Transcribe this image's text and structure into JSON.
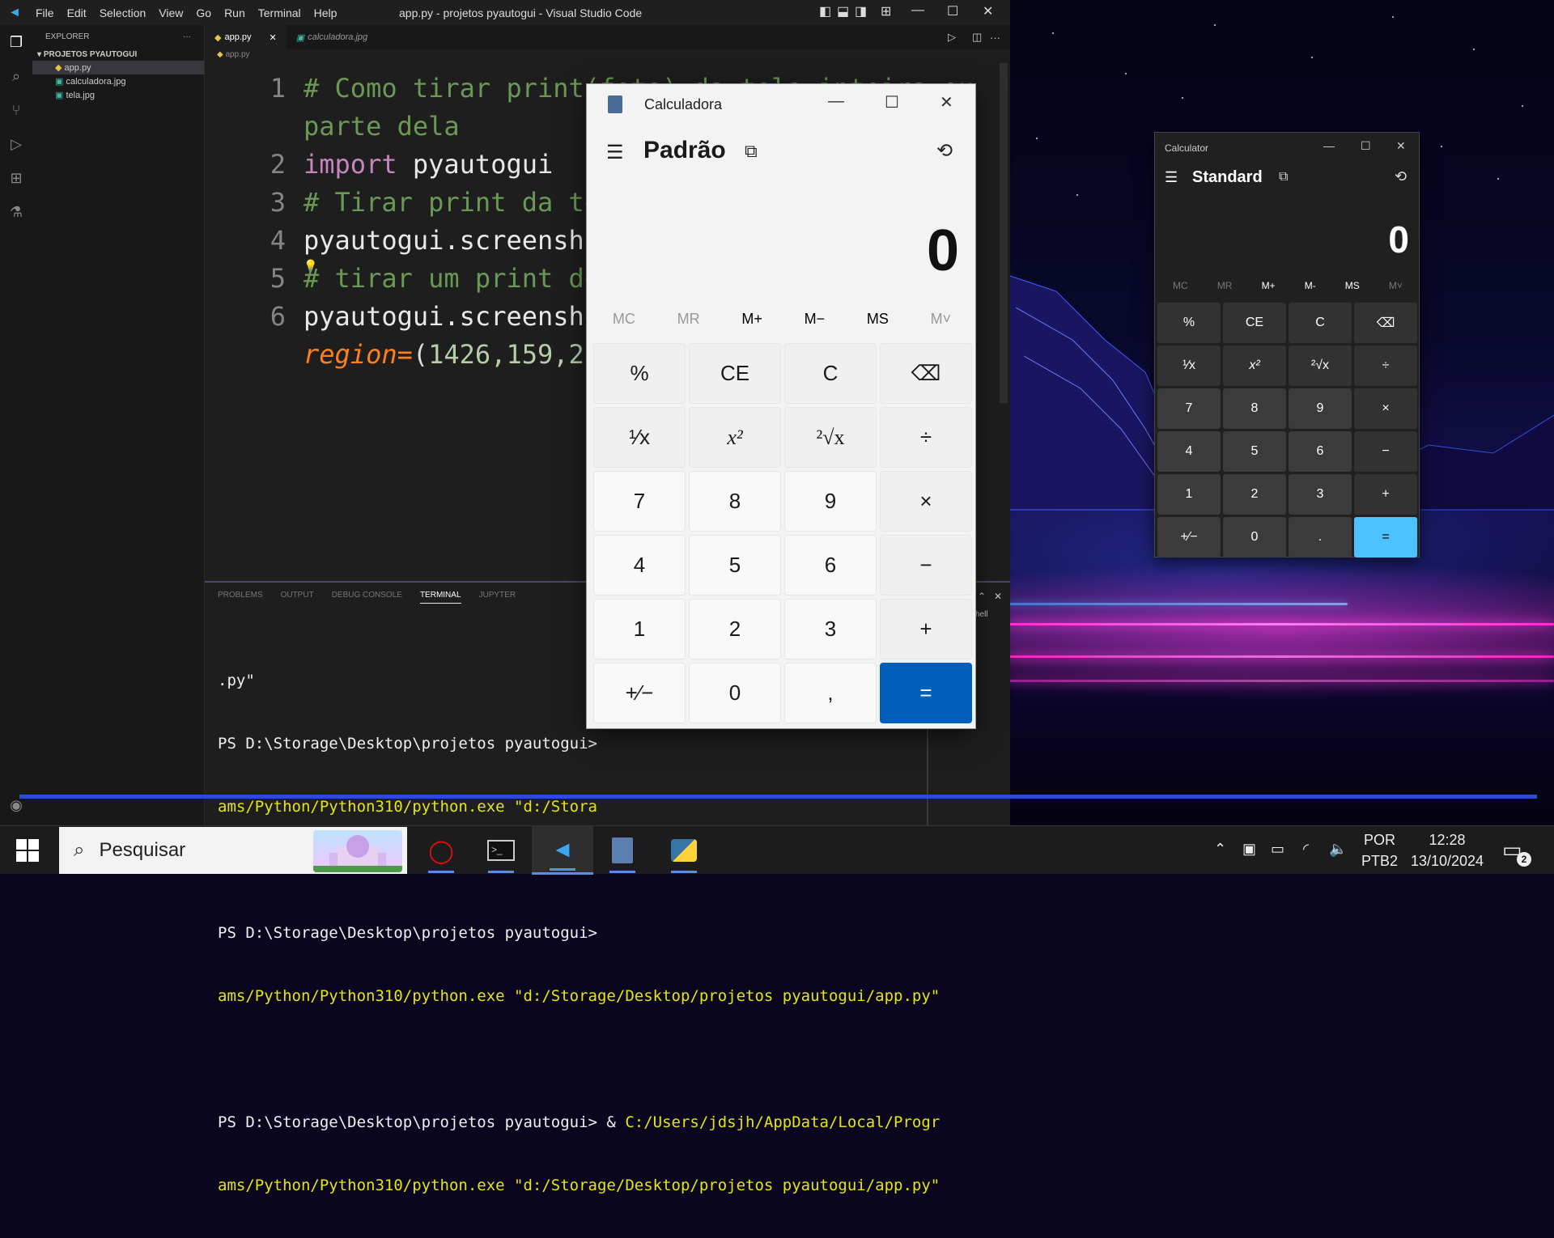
{
  "vscode": {
    "window_title": "app.py - projetos pyautogui - Visual Studio Code",
    "menu": [
      "File",
      "Edit",
      "Selection",
      "View",
      "Go",
      "Run",
      "Terminal",
      "Help"
    ],
    "explorer": {
      "header": "EXPLORER",
      "more": "···",
      "folder": "PROJETOS PYAUTOGUI",
      "files": [
        "app.py",
        "calculadora.jpg",
        "tela.jpg"
      ]
    },
    "tabs": [
      "app.py",
      "calculadora.jpg"
    ],
    "breadcrumb": "app.py",
    "code": {
      "line_numbers": [
        "1",
        "",
        "2",
        "3",
        "4",
        "5",
        "6",
        ""
      ],
      "l1": "# Como tirar print(foto) da tela inteira ou",
      "l1b": "parte dela",
      "l2_kw": "import",
      "l2_id": " pyautogui",
      "l3": "# Tirar print da te",
      "l4": "pyautogui.screensho",
      "l5": "# tirar um print de",
      "l6": "pyautogui.screensho",
      "l7_param": "region=",
      "l7_open": "(",
      "l7_nums": "1426,159,28"
    },
    "panel": {
      "tabs": [
        "PROBLEMS",
        "OUTPUT",
        "DEBUG CONSOLE",
        "TERMINAL",
        "JUPYTER"
      ],
      "shell_label": "hell",
      "terminal_lines": [
        {
          "white": ".py\"",
          "yellow": ""
        },
        {
          "white": "PS D:\\Storage\\Desktop\\projetos pyautogui>",
          "yellow": ""
        },
        {
          "white": "",
          "yellow": "ams/Python/Python310/python.exe \"d:/Stora"
        },
        {
          "white": "",
          "yellow": ""
        },
        {
          "white": "PS D:\\Storage\\Desktop\\projetos pyautogui>",
          "yellow": ""
        },
        {
          "white": "",
          "yellow": "ams/Python/Python310/python.exe \"d:/Storage/Desktop/projetos pyautogui/app.py\""
        },
        {
          "white": "",
          "yellow": ""
        },
        {
          "white": "PS D:\\Storage\\Desktop\\projetos pyautogui> & ",
          "yellow": "C:/Users/jdsjh/AppData/Local/Progr"
        },
        {
          "white": "",
          "yellow": "ams/Python/Python310/python.exe \"d:/Storage/Desktop/projetos pyautogui/app.py\""
        }
      ]
    }
  },
  "calc_pt": {
    "title": "Calculadora",
    "mode": "Padrão",
    "display": "0",
    "memory": [
      "MC",
      "MR",
      "M+",
      "M−",
      "MS",
      "M˅"
    ],
    "keys": [
      "%",
      "CE",
      "C",
      "⌫",
      "¹⁄x",
      "x²",
      "²√x",
      "÷",
      "7",
      "8",
      "9",
      "×",
      "4",
      "5",
      "6",
      "−",
      "1",
      "2",
      "3",
      "+",
      "+⁄−",
      "0",
      ",",
      "="
    ]
  },
  "calc_en": {
    "title": "Calculator",
    "mode": "Standard",
    "display": "0",
    "memory": [
      "MC",
      "MR",
      "M+",
      "M-",
      "MS",
      "M˅"
    ],
    "keys": [
      "%",
      "CE",
      "C",
      "⌫",
      "¹⁄x",
      "x²",
      "²√x",
      "÷",
      "7",
      "8",
      "9",
      "×",
      "4",
      "5",
      "6",
      "−",
      "1",
      "2",
      "3",
      "+",
      "+⁄−",
      "0",
      ".",
      "="
    ]
  },
  "taskbar": {
    "search_placeholder": "Pesquisar",
    "lang1": "POR",
    "lang2": "PTB2",
    "time": "12:28",
    "date": "13/10/2024",
    "notifications": "2"
  }
}
